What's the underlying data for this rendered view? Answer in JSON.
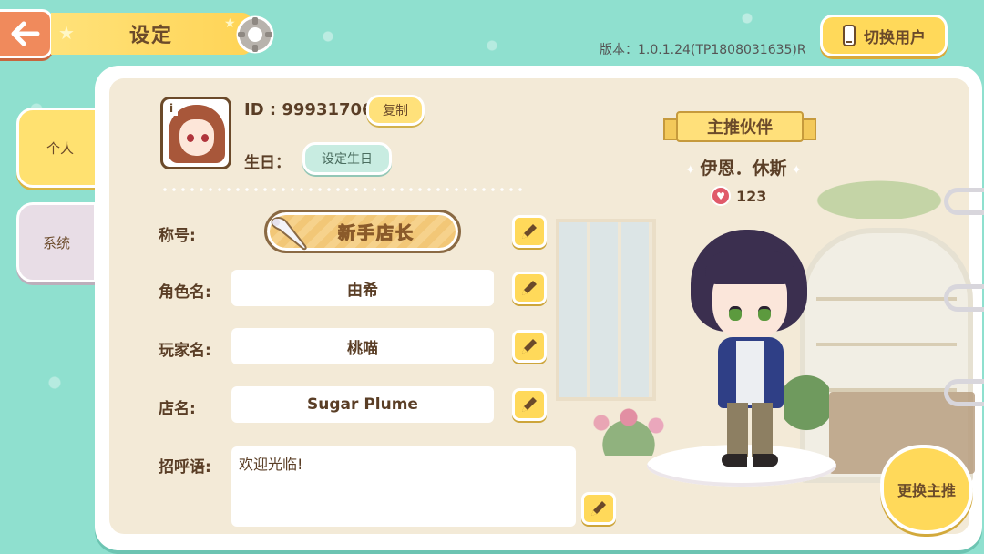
{
  "header": {
    "title": "设定",
    "switch_user_label": "切换用户",
    "version": "版本：1.0.1.24(TP1808031635)R"
  },
  "tabs": [
    {
      "label": "个人",
      "active": true
    },
    {
      "label": "系统",
      "active": false
    }
  ],
  "profile": {
    "id_text": "ID : 99931706",
    "copy_label": "复制",
    "birthday_label": "生日：",
    "birthday_button": "设定生日",
    "title_label": "称号:",
    "title_value": "新手店长",
    "role_name_label": "角色名:",
    "role_name_value": "由希",
    "player_name_label": "玩家名:",
    "player_name_value": "桃喵",
    "shop_name_label": "店名:",
    "shop_name_value": "Sugar Plume",
    "greeting_label": "招呼语:",
    "greeting_value": "欢迎光临!"
  },
  "partner": {
    "ribbon_label": "主推伙伴",
    "name": "伊恩．休斯",
    "affection": "123",
    "change_button": "更换主推"
  },
  "colors": {
    "background": "#8fe0cf",
    "accent_yellow": "#ffd95a",
    "back_button": "#f08a5c",
    "text_brown": "#5a3e26"
  },
  "icons": [
    "back-arrow-icon",
    "gear-icon",
    "phone-icon",
    "pencil-icon",
    "heart-icon",
    "info-icon"
  ]
}
